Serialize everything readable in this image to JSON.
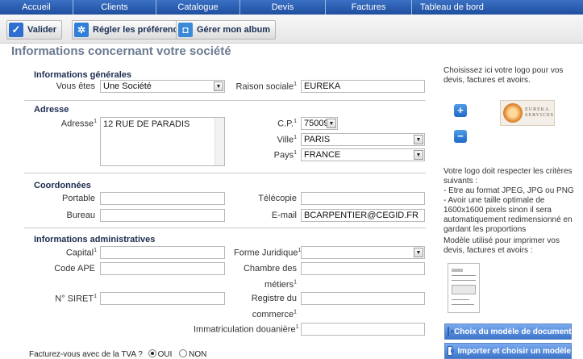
{
  "nav": {
    "items": [
      "Accueil",
      "Clients",
      "Catalogue",
      "Devis",
      "Factures",
      "Tableau de bord"
    ]
  },
  "toolbar": {
    "valider": "Valider",
    "preferences": "Régler les préférences",
    "album": "Gérer mon album"
  },
  "page_title": "Informations concernant votre société",
  "general": {
    "title": "Informations générales",
    "vous_etes_label": "Vous êtes",
    "vous_etes_value": "Une Société",
    "raison_label": "Raison sociale",
    "raison_value": "EUREKA"
  },
  "address": {
    "title": "Adresse",
    "adresse_label": "Adresse",
    "adresse_value": "12 RUE DE PARADIS",
    "cp_label": "C.P.",
    "cp_value": "75009",
    "ville_label": "Ville",
    "ville_value": "PARIS",
    "pays_label": "Pays",
    "pays_value": "FRANCE"
  },
  "contact": {
    "title": "Coordonnées",
    "portable_label": "Portable",
    "portable_value": "",
    "telecopie_label": "Télécopie",
    "telecopie_value": "",
    "bureau_label": "Bureau",
    "bureau_value": "",
    "email_label": "E-mail",
    "email_value": "BCARPENTIER@CEGID.FR"
  },
  "admin": {
    "title": "Informations administratives",
    "capital_label": "Capital",
    "forme_label": "Forme Juridique",
    "forme_value": "",
    "ape_label": "Code APE",
    "chambre_label_1": "Chambre des",
    "chambre_label_2": "métiers",
    "siret_label": "N° SIRET",
    "registre_label_1": "Registre du",
    "registre_label_2": "commerce",
    "douane_label": "Immatriculation douanière"
  },
  "tva": {
    "question": "Facturez-vous avec de la TVA ?",
    "oui": "OUI",
    "non": "NON",
    "selected": "OUI"
  },
  "logo_panel": {
    "intro": "Choisissez ici votre logo pour vos devis, factures et avoirs.",
    "logo_text_1": "EUREKA",
    "logo_text_2": "SERVICES",
    "criteria_title": "Votre logo doit respecter les critères suivants :",
    "criteria_1": "- Etre au format JPEG, JPG ou PNG",
    "criteria_2": "- Avoir une taille optimale de 1600x1600 pixels sinon il sera automatiquement redimensionné en gardant les proportions",
    "model_text": "Modèle utilisé pour imprimer vos devis, factures et avoirs :",
    "choose_button": "Choix du modèle de document",
    "import_button": "Importer et choisir un modèle"
  }
}
